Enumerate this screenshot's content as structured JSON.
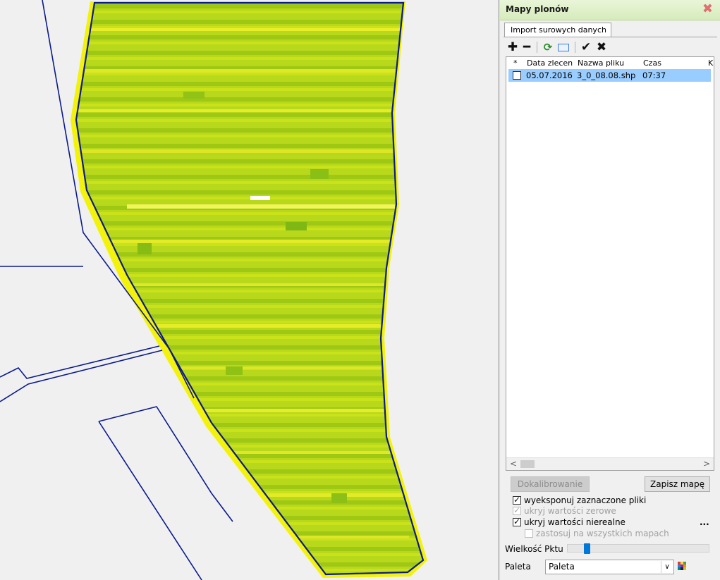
{
  "panel": {
    "title": "Mapy plonów",
    "tab_label": "Import surowych danych",
    "toolbar_icons": [
      "plus-icon",
      "minus-icon",
      "refresh-icon",
      "rectangle-icon",
      "check-icon",
      "x-icon"
    ],
    "columns": [
      "*",
      "Data zlecen",
      "Nazwa pliku",
      "Czas",
      "K"
    ],
    "rows": [
      {
        "date": "05.07.2016",
        "file": "3_0_08.08.shp",
        "time": "07:37",
        "checked": false
      }
    ],
    "btn_calibrate": "Dokalibrowanie",
    "btn_save": "Zapisz mapę",
    "opt_export": "wyeksponuj zaznaczone pliki",
    "opt_zero": "ukryj wartości zerowe",
    "opt_unreal": "ukryj wartości nierealne",
    "opt_all_maps": "zastosuj na wszystkich mapach",
    "more_label": "...",
    "point_size_label": "Wielkość Pktu",
    "point_size_value": 0.12,
    "palette_label": "Paleta",
    "palette_value": "Paleta"
  },
  "colors": {
    "field_yellow": "#e6ea10",
    "field_green": "#a6cf18",
    "boundary": "#0a1a8c",
    "selection": "#99ccff"
  }
}
